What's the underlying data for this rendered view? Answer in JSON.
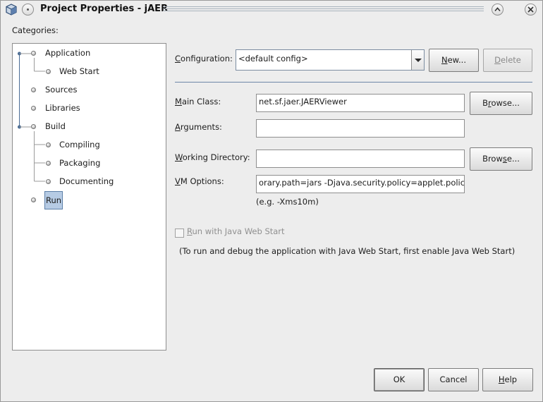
{
  "window": {
    "title": "Project Properties - jAER",
    "icons": {
      "app": "cube-icon",
      "menu": "window-menu-icon",
      "shade": "chevron-up-icon",
      "close": "close-icon"
    }
  },
  "categories": {
    "label": "Categories:",
    "items": [
      {
        "label": "Application",
        "level": 0
      },
      {
        "label": "Web Start",
        "level": 1
      },
      {
        "label": "Sources",
        "level": 0
      },
      {
        "label": "Libraries",
        "level": 0
      },
      {
        "label": "Build",
        "level": 0
      },
      {
        "label": "Compiling",
        "level": 1
      },
      {
        "label": "Packaging",
        "level": 1
      },
      {
        "label": "Documenting",
        "level": 1
      },
      {
        "label": "Run",
        "level": 0,
        "selected": true
      }
    ]
  },
  "config": {
    "label_prefix": "",
    "label_u": "C",
    "label_rest": "onfiguration:",
    "value": "<default config>",
    "new_button": "New...",
    "new_u": "N",
    "new_rest": "ew...",
    "delete_button": "Delete",
    "delete_u": "D",
    "delete_rest": "elete"
  },
  "main_class": {
    "label_u": "M",
    "label_rest": "ain Class:",
    "value": "net.sf.jaer.JAERViewer",
    "browse_pre": "B",
    "browse_u": "r",
    "browse_rest": "owse..."
  },
  "arguments": {
    "label_u": "A",
    "label_rest": "rguments:",
    "value": ""
  },
  "working_dir": {
    "label_u": "W",
    "label_rest": "orking Directory:",
    "value": "",
    "browse_pre": "Brow",
    "browse_u": "s",
    "browse_rest": "e..."
  },
  "vm_options": {
    "label_u": "V",
    "label_rest": "M Options:",
    "value": "orary.path=jars -Djava.security.policy=applet.policy",
    "hint": "(e.g. -Xms10m)"
  },
  "web_start": {
    "checkbox_u": "R",
    "checkbox_rest": "un with Java Web Start",
    "checked": false,
    "note": "(To run and debug the application with Java Web Start, first enable Java Web Start)"
  },
  "footer": {
    "ok": "OK",
    "cancel": "Cancel",
    "help_u": "H",
    "help_rest": "elp"
  },
  "colors": {
    "accent": "#6d86a8",
    "selection": "#b6cbe4"
  }
}
